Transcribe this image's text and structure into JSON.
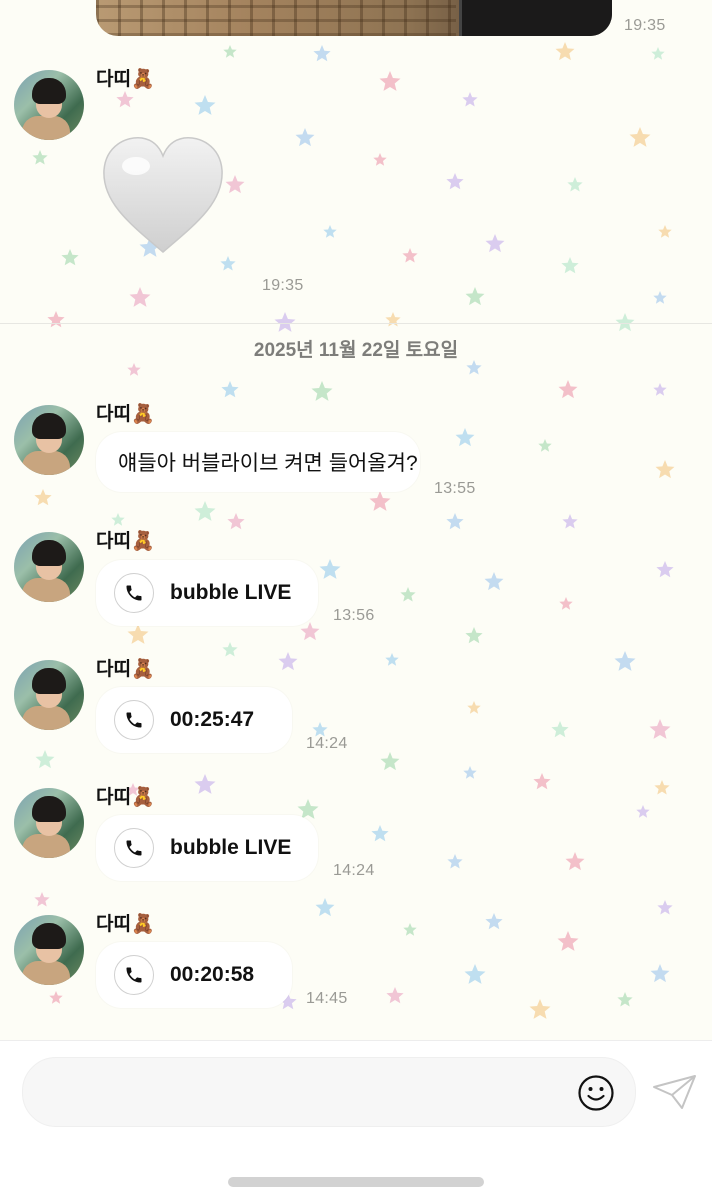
{
  "top_message": {
    "time": "19:35"
  },
  "messages": [
    {
      "sender": "다띠🧸",
      "type": "emoji",
      "emoji_name": "white-heart-icon",
      "time": "19:35"
    },
    {
      "sender": "다띠🧸",
      "type": "text",
      "text": "얘들아 버블라이브 켜면 들어올겨?",
      "time": "13:55"
    },
    {
      "sender": "다띠🧸",
      "type": "call",
      "label": "bubble LIVE",
      "time": "13:56"
    },
    {
      "sender": "다띠🧸",
      "type": "call",
      "label": "00:25:47",
      "time": "14:24"
    },
    {
      "sender": "다띠🧸",
      "type": "call",
      "label": "bubble LIVE",
      "time": "14:24"
    },
    {
      "sender": "다띠🧸",
      "type": "call",
      "label": "00:20:58",
      "time": "14:45"
    }
  ],
  "date_separator": "2025년 11월 22일 토요일",
  "composer": {
    "placeholder": "",
    "emoji_icon": "smiley-icon",
    "send_icon": "paper-plane-icon"
  },
  "colors": {
    "background": "#fdfdf6",
    "bubble": "#ffffff",
    "timestamp": "#9a9a95",
    "date_text": "#7d7d7a"
  }
}
